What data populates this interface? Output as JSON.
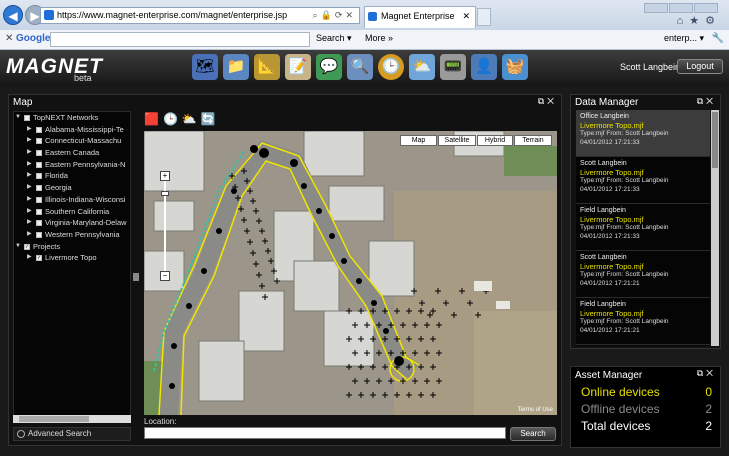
{
  "browser": {
    "url": "https://www.magnet-enterprise.com/magnet/enterprise.jsp",
    "tab_title": "Magnet Enterprise",
    "google_label": "Google",
    "search_label": "Search",
    "more_label": "More",
    "user_label": "enterp..."
  },
  "app": {
    "logo": "MAGNET",
    "logo_sub": "beta",
    "user_name": "Scott Langbein",
    "logout_label": "Logout",
    "module_icons": [
      "globe-icon",
      "folder-icon",
      "survey-tools-icon",
      "notes-icon",
      "chat-icon",
      "search-icon",
      "clock-icon",
      "cloud-weather-icon",
      "device-icon",
      "user-settings-icon",
      "basket-icon"
    ]
  },
  "map_panel": {
    "title": "Map",
    "tree": [
      {
        "label": "TopNEXT Networks",
        "level": 0,
        "expanded": true,
        "checked": false
      },
      {
        "label": "Alabama-Mississippi-Te",
        "level": 1,
        "expanded": false,
        "checked": false
      },
      {
        "label": "Connecticut-Massachu",
        "level": 1,
        "expanded": false,
        "checked": false
      },
      {
        "label": "Eastern Canada",
        "level": 1,
        "expanded": false,
        "checked": false
      },
      {
        "label": "Eastern Pennsylvania-N",
        "level": 1,
        "expanded": false,
        "checked": false
      },
      {
        "label": "Florida",
        "level": 1,
        "expanded": false,
        "checked": false
      },
      {
        "label": "Georgia",
        "level": 1,
        "expanded": false,
        "checked": false
      },
      {
        "label": "Illinois-Indiana-Wisconsi",
        "level": 1,
        "expanded": false,
        "checked": false
      },
      {
        "label": "Southern California",
        "level": 1,
        "expanded": false,
        "checked": false
      },
      {
        "label": "Virginia-Maryland-Delaw",
        "level": 1,
        "expanded": false,
        "checked": false
      },
      {
        "label": "Western Pennsylvania",
        "level": 1,
        "expanded": false,
        "checked": false
      },
      {
        "label": "Projects",
        "level": 0,
        "expanded": true,
        "checked": true
      },
      {
        "label": "Livermore Topo",
        "level": 1,
        "expanded": false,
        "checked": true
      }
    ],
    "advanced_search": "Advanced Search",
    "map_types": [
      "Map",
      "Satellite",
      "Hybrid",
      "Terrain"
    ],
    "terms": "Terms of Use",
    "location_label": "Location:",
    "location_value": "",
    "search_button": "Search"
  },
  "data_manager": {
    "title": "Data Manager",
    "items": [
      {
        "name": "Office Langbein",
        "file": "Livermore Topo.mjf",
        "meta": "Type:mjf  From: Scott Langbein",
        "time": "04/01/2012 17:21:33"
      },
      {
        "name": "Scott Langbein",
        "file": "Livermore Topo.mjf",
        "meta": "Type:mjf  From: Scott Langbein",
        "time": "04/01/2012 17:21:33"
      },
      {
        "name": "Field Langbein",
        "file": "Livermore Topo.mjf",
        "meta": "Type:mjf  From: Scott Langbein",
        "time": "04/01/2012 17:21:33"
      },
      {
        "name": "Scott Langbein",
        "file": "Livermore Topo.mjf",
        "meta": "Type:mjf  From: Scott Langbein",
        "time": "04/01/2012 17:21:21"
      },
      {
        "name": "Field Langbein",
        "file": "Livermore Topo.mjf",
        "meta": "Type:mjf  From: Scott Langbein",
        "time": "04/01/2012 17:21:21"
      }
    ]
  },
  "asset_manager": {
    "title": "Asset Manager",
    "rows": [
      {
        "label": "Online devices",
        "value": "0",
        "color": "#e8e000"
      },
      {
        "label": "Offline devices",
        "value": "2",
        "color": "#8a8a8a"
      },
      {
        "label": "Total devices",
        "value": "2",
        "color": "#ffffff"
      }
    ]
  },
  "colors": {
    "accent_yellow": "#e8e000",
    "header_dark": "#161616"
  }
}
